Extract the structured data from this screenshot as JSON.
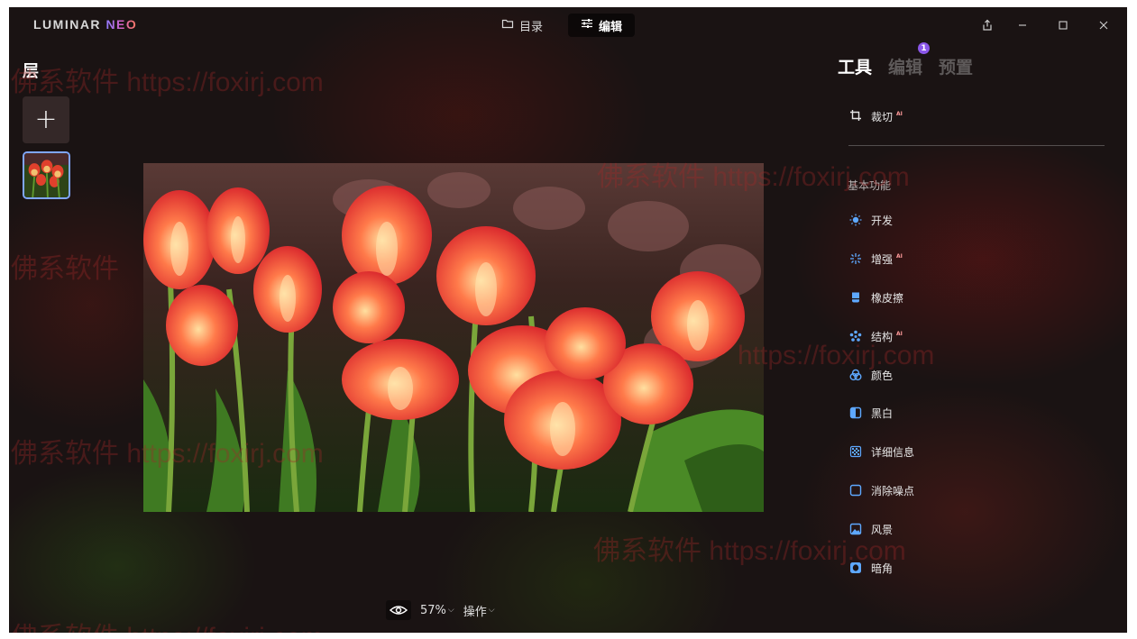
{
  "app": {
    "logo_main": "LUMINAR ",
    "logo_accent": "NEO"
  },
  "top_tabs": {
    "catalog": "目录",
    "edit": "编辑"
  },
  "layers": {
    "title": "层",
    "add_symbol": "+"
  },
  "bottom_bar": {
    "zoom": "57%",
    "actions": "操作"
  },
  "panel": {
    "tabs": {
      "tools": "工具",
      "edit": "编辑",
      "presets": "预置"
    },
    "edit_badge": "1",
    "crop": {
      "label": "裁切",
      "ai": "AI"
    },
    "basic_section": "基本功能",
    "tools": [
      {
        "label": "开发",
        "icon": "sun-icon",
        "ai": ""
      },
      {
        "label": "增强",
        "icon": "sparkle-icon",
        "ai": "AI"
      },
      {
        "label": "橡皮擦",
        "icon": "eraser-icon",
        "ai": ""
      },
      {
        "label": "结构",
        "icon": "structure-icon",
        "ai": "AI"
      },
      {
        "label": "颜色",
        "icon": "color-icon",
        "ai": ""
      },
      {
        "label": "黑白",
        "icon": "black-white-icon",
        "ai": ""
      },
      {
        "label": "详细信息",
        "icon": "details-icon",
        "ai": ""
      },
      {
        "label": "消除噪点",
        "icon": "denoise-icon",
        "ai": ""
      },
      {
        "label": "风景",
        "icon": "landscape-icon",
        "ai": ""
      },
      {
        "label": "暗角",
        "icon": "vignette-icon",
        "ai": ""
      }
    ]
  },
  "watermark": {
    "cn": "佛系软件",
    "url": "https://foxirj.com",
    "url_partial": "https://foxirj.com",
    "url_frag1": "https://",
    "url_frag2": "foxirj.com"
  },
  "colors": {
    "accent": "#8a56e8",
    "thumb_border": "#7fa6ff",
    "icon_blue": "#5ea8ff",
    "ai_badge": "#ff9a9a"
  }
}
